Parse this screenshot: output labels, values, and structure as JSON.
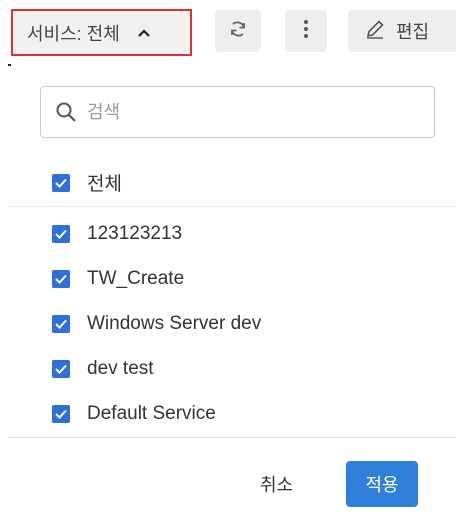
{
  "toolbar": {
    "filter_label": "서비스: 전체",
    "edit_label": "편집"
  },
  "search": {
    "placeholder": "검색"
  },
  "select_all": {
    "label": "전체",
    "checked": true
  },
  "services": [
    {
      "label": "123123213",
      "checked": true
    },
    {
      "label": "TW_Create",
      "checked": true
    },
    {
      "label": "Windows Server dev",
      "checked": true
    },
    {
      "label": "dev test",
      "checked": true
    },
    {
      "label": "Default Service",
      "checked": true
    }
  ],
  "footer": {
    "cancel_label": "취소",
    "apply_label": "적용"
  },
  "colors": {
    "accent": "#2f80dd",
    "checkbox": "#2f6fdc",
    "highlight_border": "#e03131"
  }
}
